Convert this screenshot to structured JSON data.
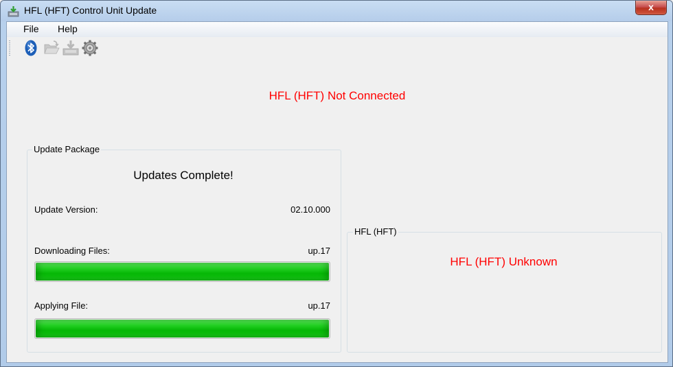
{
  "window": {
    "title": "HFL (HFT) Control Unit Update",
    "close_label": "x"
  },
  "menu": {
    "items": [
      {
        "label": "File"
      },
      {
        "label": "Help"
      }
    ]
  },
  "toolbar": {
    "icons": [
      "bluetooth-icon",
      "open-folder-icon",
      "install-package-icon",
      "settings-gear-icon"
    ]
  },
  "status": {
    "connection": "HFL (HFT) Not Connected"
  },
  "update_package": {
    "group_label": "Update Package",
    "complete_text": "Updates Complete!",
    "version_label": "Update Version:",
    "version_value": "02.10.000",
    "downloading_label": "Downloading Files:",
    "downloading_value": "up.17",
    "downloading_progress": 1.0,
    "applying_label": "Applying File:",
    "applying_value": "up.17",
    "applying_progress": 1.0
  },
  "hfl": {
    "group_label": "HFL (HFT)",
    "status": "HFL (HFT) Unknown"
  },
  "colors": {
    "error_text": "#ff0000",
    "progress_green": "#06b706"
  }
}
